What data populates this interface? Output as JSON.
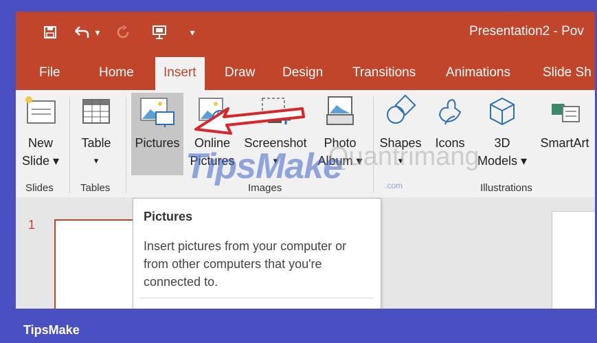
{
  "title": "Presentation2 - Pov",
  "qat": {
    "save": "save-icon",
    "undo": "undo-icon",
    "undo_dropdown": "▾",
    "redo": "redo-icon",
    "present": "present-icon",
    "customize": "▾"
  },
  "tabs": [
    "File",
    "Home",
    "Insert",
    "Draw",
    "Design",
    "Transitions",
    "Animations",
    "Slide Sh"
  ],
  "ribbon": {
    "new_slide": {
      "line1": "New",
      "line2": "Slide ▾"
    },
    "table": {
      "line1": "Table",
      "line2": "▾"
    },
    "pictures": "Pictures",
    "online_pictures": {
      "line1": "Online",
      "line2": "Pictures"
    },
    "screenshot": {
      "line1": "Screenshot",
      "line2": "▾"
    },
    "photo_album": {
      "line1": "Photo",
      "line2": "Album ▾"
    },
    "shapes": {
      "line1": "Shapes",
      "line2": "▾"
    },
    "icons": "Icons",
    "models3d": {
      "line1": "3D",
      "line2": "Models ▾"
    },
    "smartart": "SmartArt",
    "groups": {
      "slides": "Slides",
      "tables": "Tables",
      "images": "Images",
      "illustrations": "Illustrations"
    }
  },
  "slide_panel": {
    "slide_number": "1"
  },
  "tooltip": {
    "title": "Pictures",
    "body": "Insert pictures from your computer or from other computers that you're connected to."
  },
  "watermark": {
    "main": "TipsMake",
    "sub": ".com",
    "secondary": "Quantrimang"
  },
  "footer": {
    "brand": "TipsMake"
  },
  "colors": {
    "accent": "#c0452a",
    "frame": "#4a4fc1",
    "ribbon": "#f1f1f1"
  }
}
